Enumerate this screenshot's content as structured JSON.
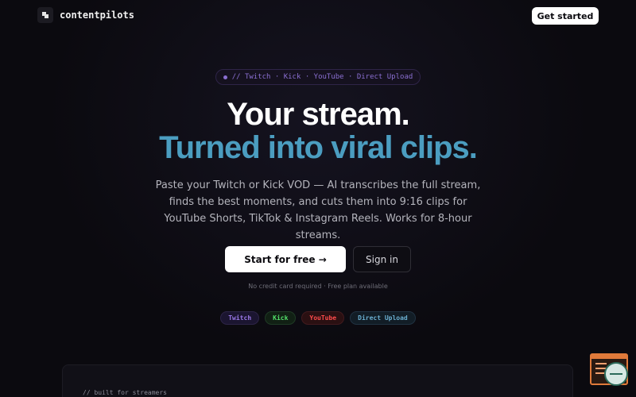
{
  "header": {
    "brand_name": "contentpilots",
    "get_started_label": "Get started"
  },
  "hero": {
    "platform_pill": "// Twitch · Kick · YouTube · Direct Upload",
    "headline_line1": "Your stream.",
    "headline_line2": "Turned into viral clips.",
    "subtitle": "Paste your Twitch or Kick VOD — AI transcribes the full stream, finds the best moments, and cuts them into 9:16 clips for YouTube Shorts, TikTok & Instagram Reels. Works for 8-hour streams.",
    "start_label": "Start for free →",
    "signin_label": "Sign in",
    "fine_print": "No credit card required · Free plan available"
  },
  "platform_tags": [
    {
      "label": "Twitch",
      "color": "#9a78e8"
    },
    {
      "label": "Kick",
      "color": "#53e06a"
    },
    {
      "label": "YouTube",
      "color": "#ff4b4b"
    },
    {
      "label": "Direct Upload",
      "color": "#6aaed0"
    }
  ],
  "section": {
    "caption": "// built for streamers"
  },
  "colors": {
    "background": "#0b0a0f",
    "accent_blue": "#4b9dc0",
    "accent_purple": "#8a6fd1"
  }
}
